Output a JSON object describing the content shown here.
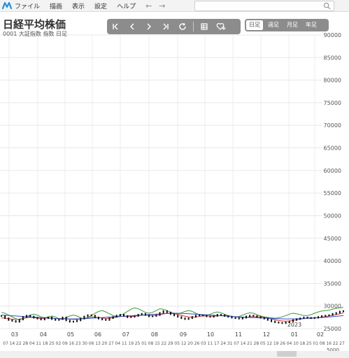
{
  "app": {
    "logo": "app-logo-icon"
  },
  "menu": {
    "items": [
      "ファイル",
      "描画",
      "表示",
      "設定",
      "ヘルプ"
    ],
    "back_icon": "arrow-left-icon",
    "forward_icon": "arrow-right-icon"
  },
  "search": {
    "value": "",
    "placeholder": "",
    "icon": "search-icon"
  },
  "header": {
    "title": "日経平均株価",
    "subtitle": "0001  大証指数  指数  日足"
  },
  "toolbar": {
    "buttons": [
      "first-page-icon",
      "prev-icon",
      "next-icon",
      "last-page-icon",
      "refresh-icon",
      "table-icon",
      "favorite-add-icon"
    ]
  },
  "period": {
    "tabs": [
      "日足",
      "週足",
      "月足",
      "年足"
    ],
    "active": "日足"
  },
  "chart_data": {
    "type": "candlestick",
    "title": "日経平均株価",
    "ylim": [
      25000,
      90000
    ],
    "yticks": [
      25000,
      30000,
      35000,
      40000,
      45000,
      50000,
      55000,
      60000,
      65000,
      70000,
      75000,
      80000,
      85000,
      90000
    ],
    "ytick_labels": [
      "25000",
      "30000",
      "35000",
      "40000",
      "45000",
      "50000",
      "55000",
      "60000",
      "65000",
      "70000",
      "75000",
      "80000",
      "85000",
      "90000"
    ],
    "month_labels": [
      "03",
      "04",
      "05",
      "06",
      "07",
      "08",
      "09",
      "10",
      "11",
      "12",
      "01",
      "02"
    ],
    "year_label": "2023",
    "day_labels": [
      "07",
      "14",
      "22",
      "28",
      "04",
      "11",
      "18",
      "25",
      "02",
      "09",
      "16",
      "23",
      "30",
      "06",
      "13",
      "20",
      "27",
      "04",
      "11",
      "19",
      "25",
      "01",
      "08",
      "15",
      "22",
      "29",
      "05",
      "12",
      "20",
      "26",
      "03",
      "11",
      "17",
      "24",
      "31",
      "07",
      "14",
      "21",
      "28",
      "05",
      "12",
      "19",
      "26",
      "04",
      "10",
      "18",
      "25",
      "01",
      "08",
      "16",
      "22",
      "27"
    ],
    "bottom_value": "5000",
    "price_series": [
      27800,
      27300,
      26900,
      26700,
      26500,
      27000,
      27600,
      27900,
      27700,
      27400,
      27200,
      27000,
      27300,
      27500,
      27100,
      26900,
      27100,
      27500,
      26800,
      26500,
      26600,
      26800,
      27200,
      27700,
      28000,
      27900,
      27500,
      27200,
      27000,
      26900,
      27300,
      27600,
      27900,
      28100,
      27800,
      27500,
      27600,
      27800,
      28100,
      28300,
      28000,
      27700,
      27800,
      28000,
      28500,
      28900,
      28600,
      28200,
      27900,
      27600,
      27300,
      27100,
      27300,
      27600,
      27900,
      28000,
      27900,
      27700,
      27600,
      27800,
      28100,
      28000,
      27800,
      27600,
      27400,
      27300,
      27200,
      27400,
      27700,
      27900,
      27800,
      27600,
      27400,
      27200,
      26900,
      26600,
      26400,
      26300,
      26200,
      26400,
      26600,
      26900,
      27100,
      27300,
      27500,
      27400,
      27300,
      27400,
      27600,
      27800,
      27900,
      28000,
      28300,
      28500,
      28800,
      28900
    ],
    "ma_series": [
      {
        "color": "#d03030",
        "values": [
          27400,
          27300,
          27200,
          27100,
          27050,
          27100,
          27250,
          27400,
          27500,
          27450,
          27350,
          27250,
          27300,
          27400,
          27350,
          27250,
          27200,
          27250,
          27200,
          27100,
          27050,
          27050,
          27150,
          27300,
          27450,
          27550,
          27550,
          27450,
          27350,
          27250,
          27300,
          27400,
          27550,
          27700,
          27750,
          27700,
          27700,
          27750,
          27850,
          27950,
          28000,
          27950,
          27900,
          27950,
          28050,
          28250,
          28400,
          28400,
          28300,
          28150,
          27950,
          27750,
          27600,
          27550,
          27600,
          27700,
          27800,
          27800,
          27750,
          27750,
          27850,
          27900,
          27900,
          27850,
          27750,
          27600,
          27500,
          27450,
          27500,
          27600,
          27650,
          27650,
          27600,
          27500,
          27350,
          27150,
          26950,
          26800,
          26700,
          26650,
          26700,
          26800,
          26950,
          27100,
          27250,
          27350,
          27400,
          27400,
          27450,
          27550,
          27650,
          27800,
          27950,
          28100,
          28300,
          28500
        ]
      },
      {
        "color": "#3a9a3a",
        "values": [
          28600,
          28400,
          28000,
          27600,
          27200,
          27000,
          27200,
          27600,
          28000,
          28200,
          28000,
          27600,
          27400,
          27600,
          27800,
          27600,
          27200,
          27000,
          27400,
          27800,
          28000,
          27800,
          27400,
          27200,
          27400,
          27900,
          28400,
          28800,
          29000,
          28700,
          28300,
          27900,
          27700,
          27900,
          28300,
          28800,
          29300,
          29600,
          29400,
          29000,
          28600,
          28400,
          28600,
          29000,
          29400,
          29300,
          29000,
          28600,
          28400,
          28300,
          28500,
          28800,
          29000,
          28800,
          28400,
          28100,
          27900,
          27900,
          28200,
          28500,
          28700,
          28500,
          28200,
          27900,
          27700,
          27600,
          27700,
          28000,
          28300,
          28500,
          28400,
          28100,
          27800,
          27600,
          27500,
          27400,
          27300,
          27400,
          27600,
          27900,
          28200,
          28400,
          28300,
          28100,
          27900,
          27900,
          28100,
          28400,
          28700,
          28900,
          29000,
          29100,
          29300,
          29500,
          29600,
          29700
        ]
      },
      {
        "color": "#3050d0",
        "values": [
          28000,
          27950,
          27900,
          27850,
          27800,
          27750,
          27700,
          27650,
          27600,
          27550,
          27500,
          27450,
          27400,
          27350,
          27300,
          27250,
          27200,
          27180,
          27160,
          27150,
          27150,
          27160,
          27180,
          27200,
          27250,
          27300,
          27350,
          27400,
          27450,
          27500,
          27550,
          27600,
          27650,
          27700,
          27750,
          27800,
          27850,
          27900,
          27950,
          28000,
          28050,
          28100,
          28150,
          28200,
          28250,
          28300,
          28350,
          28380,
          28400,
          28400,
          28380,
          28350,
          28300,
          28250,
          28200,
          28150,
          28100,
          28050,
          28000,
          27950,
          27900,
          27850,
          27800,
          27750,
          27700,
          27650,
          27600,
          27560,
          27520,
          27480,
          27440,
          27400,
          27360,
          27320,
          27280,
          27240,
          27200,
          27180,
          27160,
          27150,
          27150,
          27160,
          27180,
          27200,
          27230,
          27260,
          27300,
          27350,
          27400,
          27460,
          27520,
          27580,
          27650,
          27720,
          27800,
          27880
        ]
      }
    ]
  },
  "scrollbar": {
    "label": "scrollbar"
  }
}
